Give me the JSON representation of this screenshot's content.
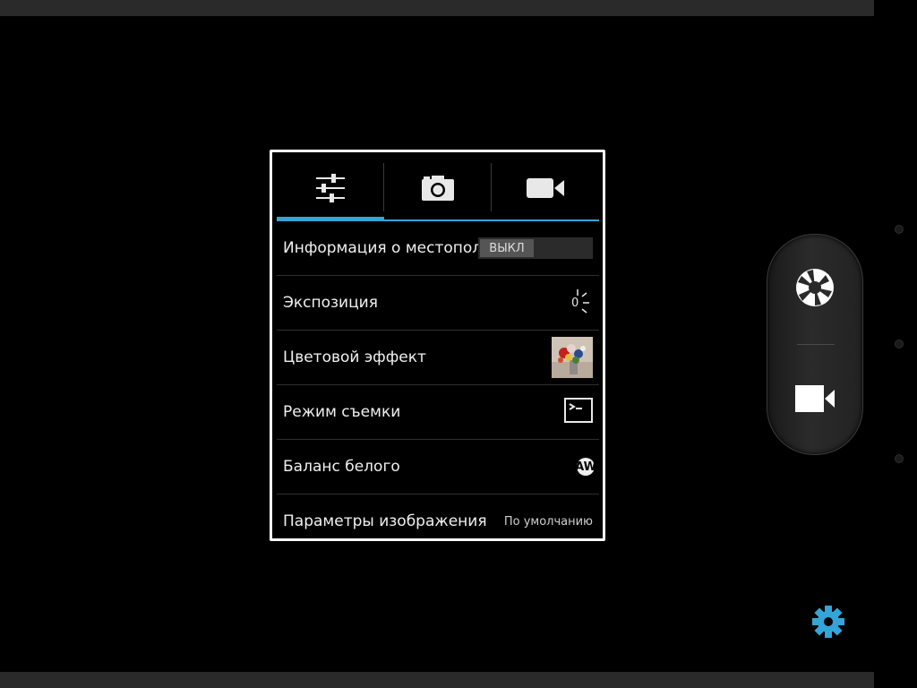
{
  "tabs": [
    {
      "icon": "sliders-icon",
      "active": true
    },
    {
      "icon": "camera-icon",
      "active": false
    },
    {
      "icon": "video-camera-icon",
      "active": false
    }
  ],
  "settings": {
    "location": {
      "label": "Информация о местоположении",
      "value": "ВЫКЛ"
    },
    "exposure": {
      "label": "Экспозиция",
      "value": "0"
    },
    "color_effect": {
      "label": "Цветовой эффект"
    },
    "scene_mode": {
      "label": "Режим съемки"
    },
    "white_balance": {
      "label": "Баланс белого",
      "value": "AW"
    },
    "picture_params": {
      "label": "Параметры изображения",
      "value": "По умолчанию"
    }
  },
  "colors": {
    "accent": "#33a5d8",
    "popup_border": "#ffffff",
    "background": "#000000"
  },
  "panel": {
    "shutter_icon": "shutter-icon",
    "video_icon": "video-record-icon",
    "settings_icon": "gear-icon"
  }
}
